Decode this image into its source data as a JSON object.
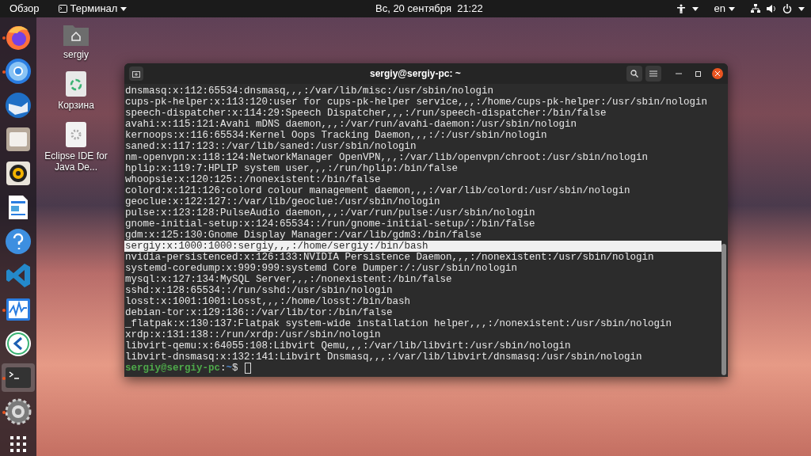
{
  "top_bar": {
    "activities": "Обзор",
    "app_menu": "Терминал",
    "clock": "Вс, 20 сентября  21:22",
    "language": "en"
  },
  "dock": [
    {
      "kind": "firefox",
      "running": true,
      "selected": false
    },
    {
      "kind": "chromium",
      "running": true,
      "selected": false
    },
    {
      "kind": "mail",
      "running": false,
      "selected": false
    },
    {
      "kind": "files",
      "running": false,
      "selected": false
    },
    {
      "kind": "music",
      "running": false,
      "selected": false
    },
    {
      "kind": "writer",
      "running": false,
      "selected": false
    },
    {
      "kind": "help",
      "running": false,
      "selected": false
    },
    {
      "kind": "vscode",
      "running": false,
      "selected": false
    },
    {
      "kind": "monitor",
      "running": true,
      "selected": false
    },
    {
      "kind": "remote",
      "running": false,
      "selected": false
    },
    {
      "kind": "terminal",
      "running": true,
      "selected": true
    },
    {
      "kind": "settings",
      "running": true,
      "selected": false
    },
    {
      "kind": "apps",
      "running": false,
      "selected": false
    }
  ],
  "desktop_icons": [
    {
      "kind": "home",
      "label": "sergiy"
    },
    {
      "kind": "trash",
      "label": "Корзина"
    },
    {
      "kind": "launcher",
      "label": "Eclipse IDE for Java De..."
    }
  ],
  "terminal": {
    "title": "sergiy@sergiy-pc: ~",
    "lines": [
      {
        "text": "dnsmasq:x:112:65534:dnsmasq,,,:/var/lib/misc:/usr/sbin/nologin",
        "selected": false
      },
      {
        "text": "cups-pk-helper:x:113:120:user for cups-pk-helper service,,,:/home/cups-pk-helper:/usr/sbin/nologin",
        "selected": false
      },
      {
        "text": "speech-dispatcher:x:114:29:Speech Dispatcher,,,:/run/speech-dispatcher:/bin/false",
        "selected": false
      },
      {
        "text": "avahi:x:115:121:Avahi mDNS daemon,,,:/var/run/avahi-daemon:/usr/sbin/nologin",
        "selected": false
      },
      {
        "text": "kernoops:x:116:65534:Kernel Oops Tracking Daemon,,,:/:/usr/sbin/nologin",
        "selected": false
      },
      {
        "text": "saned:x:117:123::/var/lib/saned:/usr/sbin/nologin",
        "selected": false
      },
      {
        "text": "nm-openvpn:x:118:124:NetworkManager OpenVPN,,,:/var/lib/openvpn/chroot:/usr/sbin/nologin",
        "selected": false
      },
      {
        "text": "hplip:x:119:7:HPLIP system user,,,:/run/hplip:/bin/false",
        "selected": false
      },
      {
        "text": "whoopsie:x:120:125::/nonexistent:/bin/false",
        "selected": false
      },
      {
        "text": "colord:x:121:126:colord colour management daemon,,,:/var/lib/colord:/usr/sbin/nologin",
        "selected": false
      },
      {
        "text": "geoclue:x:122:127::/var/lib/geoclue:/usr/sbin/nologin",
        "selected": false
      },
      {
        "text": "pulse:x:123:128:PulseAudio daemon,,,:/var/run/pulse:/usr/sbin/nologin",
        "selected": false
      },
      {
        "text": "gnome-initial-setup:x:124:65534::/run/gnome-initial-setup/:/bin/false",
        "selected": false
      },
      {
        "text": "gdm:x:125:130:Gnome Display Manager:/var/lib/gdm3:/bin/false",
        "selected": false
      },
      {
        "text": "sergiy:x:1000:1000:sergiy,,,:/home/sergiy:/bin/bash",
        "selected": true
      },
      {
        "text": "nvidia-persistenced:x:126:133:NVIDIA Persistence Daemon,,,:/nonexistent:/usr/sbin/nologin",
        "selected": false
      },
      {
        "text": "systemd-coredump:x:999:999:systemd Core Dumper:/:/usr/sbin/nologin",
        "selected": false
      },
      {
        "text": "mysql:x:127:134:MySQL Server,,,:/nonexistent:/bin/false",
        "selected": false
      },
      {
        "text": "sshd:x:128:65534::/run/sshd:/usr/sbin/nologin",
        "selected": false
      },
      {
        "text": "losst:x:1001:1001:Losst,,,:/home/losst:/bin/bash",
        "selected": false
      },
      {
        "text": "debian-tor:x:129:136::/var/lib/tor:/bin/false",
        "selected": false
      },
      {
        "text": "_flatpak:x:130:137:Flatpak system-wide installation helper,,,:/nonexistent:/usr/sbin/nologin",
        "selected": false
      },
      {
        "text": "xrdp:x:131:138::/run/xrdp:/usr/sbin/nologin",
        "selected": false
      },
      {
        "text": "libvirt-qemu:x:64055:108:Libvirt Qemu,,,:/var/lib/libvirt:/usr/sbin/nologin",
        "selected": false
      },
      {
        "text": "libvirt-dnsmasq:x:132:141:Libvirt Dnsmasq,,,:/var/lib/libvirt/dnsmasq:/usr/sbin/nologin",
        "selected": false
      }
    ],
    "prompt": {
      "user_host": "sergiy@sergiy-pc",
      "separator": ":",
      "path": "~",
      "symbol": "$"
    }
  }
}
